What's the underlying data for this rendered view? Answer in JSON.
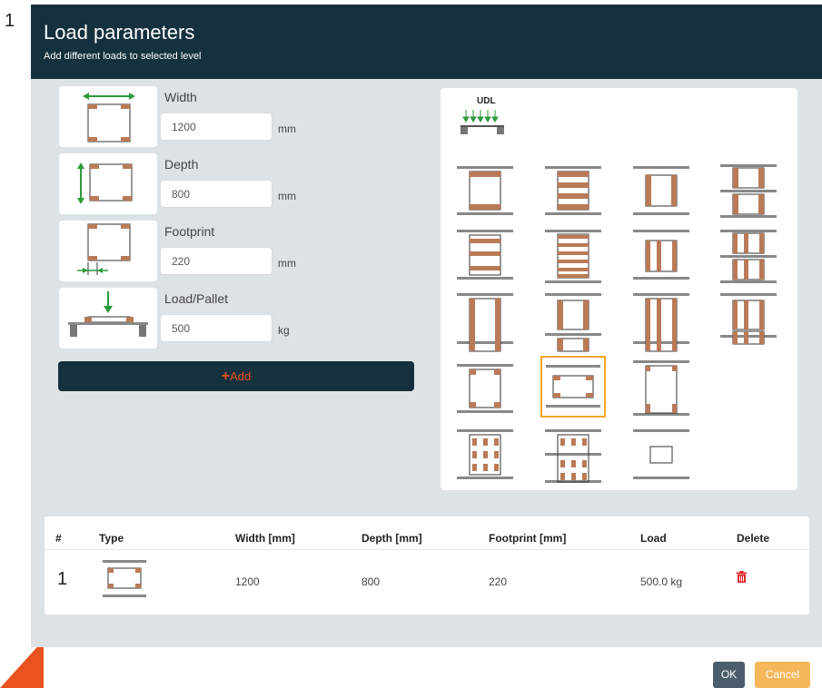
{
  "step_number": "1",
  "dialog": {
    "title": "Load parameters",
    "subtitle": "Add different loads to selected level"
  },
  "params": [
    {
      "label": "Width",
      "value": "1200",
      "unit": "mm",
      "icon": "width-arrow-icon"
    },
    {
      "label": "Depth",
      "value": "800",
      "unit": "mm",
      "icon": "depth-arrow-icon"
    },
    {
      "label": "Footprint",
      "value": "220",
      "unit": "mm",
      "icon": "footprint-icon"
    },
    {
      "label": "Load/Pallet",
      "value": "500",
      "unit": "kg",
      "icon": "load-pallet-icon"
    }
  ],
  "add_button": {
    "plus": "+",
    "label": "Add"
  },
  "load_types": {
    "udl_label": "UDL",
    "selected_index": 13,
    "count": 19
  },
  "table": {
    "headers": [
      "#",
      "Type",
      "Width [mm]",
      "Depth [mm]",
      "Footprint [mm]",
      "Load",
      "Delete"
    ],
    "rows": [
      {
        "num": "1",
        "width": "1200",
        "depth": "800",
        "footprint": "220",
        "load": "500.0 kg"
      }
    ]
  },
  "footer": {
    "ok": "OK",
    "cancel": "Cancel"
  },
  "colors": {
    "header": "#15313f",
    "accent": "#e8531f",
    "selected": "#f5a623",
    "pallet_wood": "#b97a57",
    "arrow": "#2e9a3c"
  }
}
